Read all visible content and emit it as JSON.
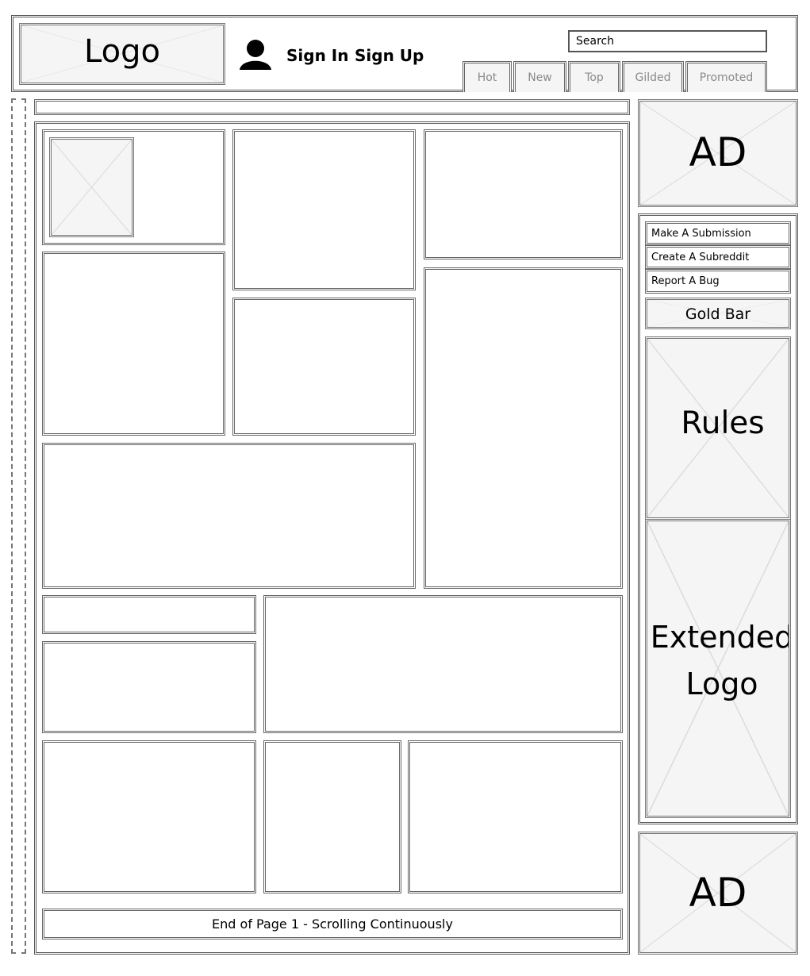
{
  "header": {
    "logo_text": "Logo",
    "sign_in": "Sign In",
    "sign_up": "Sign Up",
    "search_placeholder": "Search",
    "tabs": [
      {
        "label": "Hot"
      },
      {
        "label": "New"
      },
      {
        "label": "Top"
      },
      {
        "label": "Gilded"
      },
      {
        "label": "Promoted"
      }
    ]
  },
  "sidebar": {
    "ad_top": "AD",
    "links": [
      {
        "label": "Make A Submission"
      },
      {
        "label": "Create A Subreddit"
      },
      {
        "label": "Report A Bug"
      }
    ],
    "gold_bar": "Gold Bar",
    "rules": "Rules",
    "extended_logo": "Extended\nLogo",
    "ad_bottom": "AD"
  },
  "main": {
    "footer_text": "End of Page 1 - Scrolling Continuously"
  }
}
